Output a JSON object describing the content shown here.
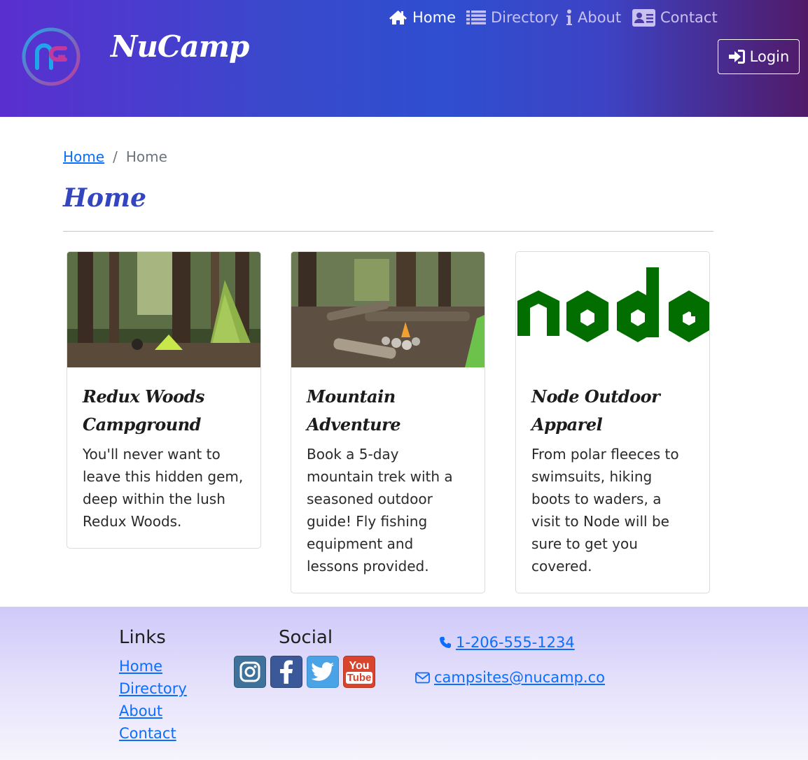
{
  "header": {
    "brand": "NuCamp",
    "nav": [
      {
        "label": "Home",
        "icon": "home-icon",
        "active": true
      },
      {
        "label": "Directory",
        "icon": "list-icon",
        "active": false
      },
      {
        "label": "About",
        "icon": "info-icon",
        "active": false
      },
      {
        "label": "Contact",
        "icon": "address-card-icon",
        "active": false
      }
    ],
    "login_label": "Login"
  },
  "breadcrumb": {
    "link": "Home",
    "separator": "/",
    "current": "Home"
  },
  "page_title": "Home",
  "cards": [
    {
      "title": "Redux Woods Campground",
      "text": "You'll never want to leave this hidden gem, deep within the lush Redux Woods."
    },
    {
      "title": "Mountain Adventure",
      "text": "Book a 5-day mountain trek with a seasoned outdoor guide! Fly fishing equipment and lessons provided."
    },
    {
      "title": "Node Outdoor Apparel",
      "text": "From polar fleeces to swimsuits, hiking boots to waders, a visit to Node will be sure to get you covered.",
      "logo_text": "node"
    }
  ],
  "footer": {
    "links_heading": "Links",
    "links": [
      "Home",
      "Directory",
      "About",
      "Contact"
    ],
    "social_heading": "Social",
    "social": [
      "instagram-icon",
      "facebook-icon",
      "twitter-icon",
      "youtube-icon"
    ],
    "youtube_text": [
      "You",
      "Tube"
    ],
    "phone": "1-206-555-1234",
    "email": "campsites@nucamp.co"
  },
  "colors": {
    "accent": "#3346c0",
    "link": "#0d6efd",
    "node_green": "#026e00"
  }
}
